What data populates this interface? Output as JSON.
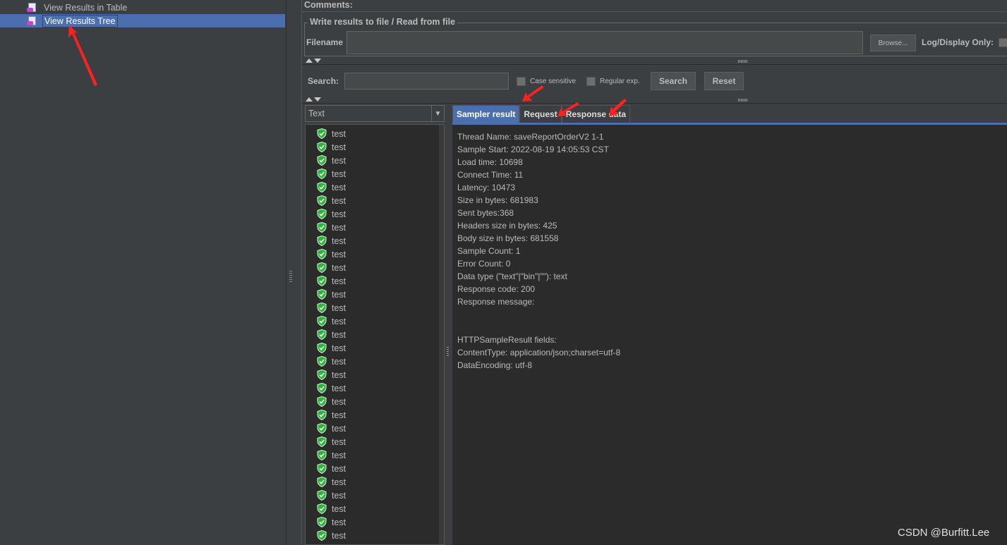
{
  "tree": {
    "items": [
      {
        "label": "View Results in Table"
      },
      {
        "label": "View Results Tree",
        "selected": true
      }
    ]
  },
  "panel": {
    "comments_label": "Comments:",
    "file_group_title": "Write results to file / Read from file",
    "filename_label": "Filename",
    "filename_value": "",
    "browse_label": "Browse...",
    "log_display_label": "Log/Display Only:"
  },
  "search": {
    "label": "Search:",
    "value": "",
    "case_sensitive_label": "Case sensitive",
    "regex_label": "Regular exp.",
    "search_button": "Search",
    "reset_button": "Reset"
  },
  "renderer": {
    "selected": "Text"
  },
  "results": {
    "items": [
      "test",
      "test",
      "test",
      "test",
      "test",
      "test",
      "test",
      "test",
      "test",
      "test",
      "test",
      "test",
      "test",
      "test",
      "test",
      "test",
      "test",
      "test",
      "test",
      "test",
      "test",
      "test",
      "test",
      "test",
      "test",
      "test",
      "test",
      "test",
      "test",
      "test",
      "test"
    ]
  },
  "tabs": [
    {
      "label": "Sampler result",
      "active": true
    },
    {
      "label": "Request",
      "active": false
    },
    {
      "label": "Response data",
      "active": false
    }
  ],
  "sampler_result": {
    "lines": [
      "Thread Name: saveReportOrderV2 1-1",
      "Sample Start: 2022-08-19 14:05:53 CST",
      "Load time: 10698",
      "Connect Time: 11",
      "Latency: 10473",
      "Size in bytes: 681983",
      "Sent bytes:368",
      "Headers size in bytes: 425",
      "Body size in bytes: 681558",
      "Sample Count: 1",
      "Error Count: 0",
      "Data type (\"text\"|\"bin\"|\"\"): text",
      "Response code: 200",
      "Response message: ",
      "",
      "",
      "HTTPSampleResult fields:",
      "ContentType: application/json;charset=utf-8",
      "DataEncoding: utf-8"
    ]
  },
  "watermark": "CSDN @Burfitt.Lee",
  "colors": {
    "background": "#3c3f41",
    "selection": "#4b6eaf",
    "success_green": "#2bb53a",
    "annotation_red": "#ff2020"
  }
}
